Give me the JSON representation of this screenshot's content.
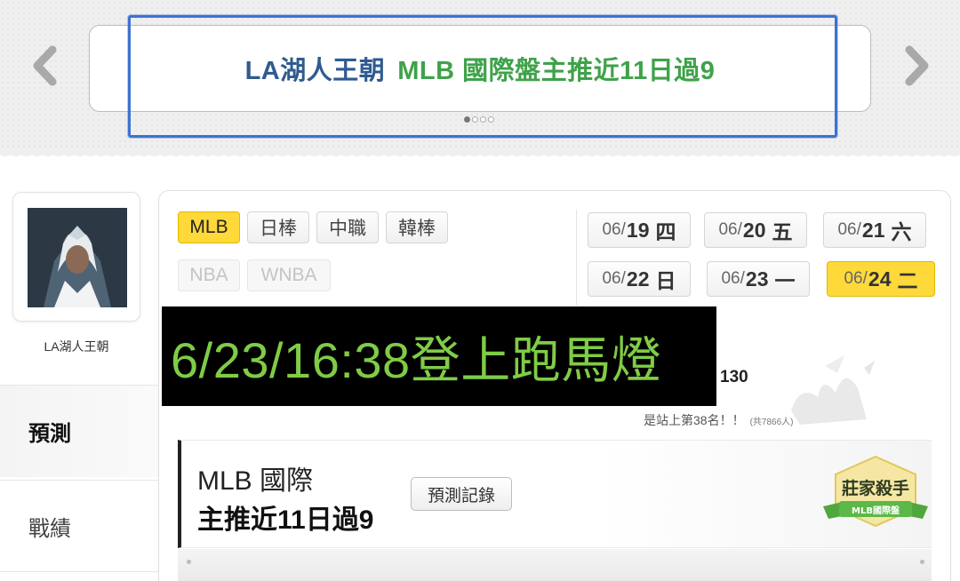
{
  "marquee": {
    "part1": "LA湖人王朝",
    "part2": "MLB 國際盤主推近11日過9",
    "prev_icon": "chevron-left-icon",
    "next_icon": "chevron-right-icon",
    "page_count": 4,
    "current_page": 1
  },
  "profile": {
    "username": "LA湖人王朝",
    "avatar_icon": "user-avatar"
  },
  "sidebar": {
    "tabs": [
      {
        "label": "預測",
        "active": true
      },
      {
        "label": "戰績",
        "active": false
      }
    ]
  },
  "leagues": {
    "row1": [
      {
        "label": "MLB",
        "selected": true,
        "enabled": true
      },
      {
        "label": "日棒",
        "selected": false,
        "enabled": true
      },
      {
        "label": "中職",
        "selected": false,
        "enabled": true
      },
      {
        "label": "韓棒",
        "selected": false,
        "enabled": true
      }
    ],
    "row2": [
      {
        "label": "NBA",
        "selected": false,
        "enabled": false
      },
      {
        "label": "WNBA",
        "selected": false,
        "enabled": false
      }
    ]
  },
  "dates": [
    {
      "month": "06/",
      "day": "19",
      "weekday": "四",
      "selected": false
    },
    {
      "month": "06/",
      "day": "20",
      "weekday": "五",
      "selected": false
    },
    {
      "month": "06/",
      "day": "21",
      "weekday": "六",
      "selected": false
    },
    {
      "month": "06/",
      "day": "22",
      "weekday": "日",
      "selected": false
    },
    {
      "month": "06/",
      "day": "23",
      "weekday": "一",
      "selected": false
    },
    {
      "month": "06/",
      "day": "24",
      "weekday": "二",
      "selected": true
    }
  ],
  "overlay_text": "6/23/16:38登上跑馬燈",
  "score_text": "130",
  "rank": {
    "text": "是站上第38名！！",
    "total": "(共7866人)"
  },
  "prediction": {
    "line1": "MLB 國際",
    "line2": "主推近11日過9",
    "record_button": "預測記錄"
  },
  "badge": {
    "title": "莊家殺手",
    "subtitle": "MLB國際盤"
  },
  "colors": {
    "accent_yellow": "#ffd93a",
    "marquee_blue": "#2f5b8f",
    "marquee_green": "#3fa24a",
    "overlay_green": "#7fcc46",
    "highlight_frame": "#3d73d1"
  }
}
